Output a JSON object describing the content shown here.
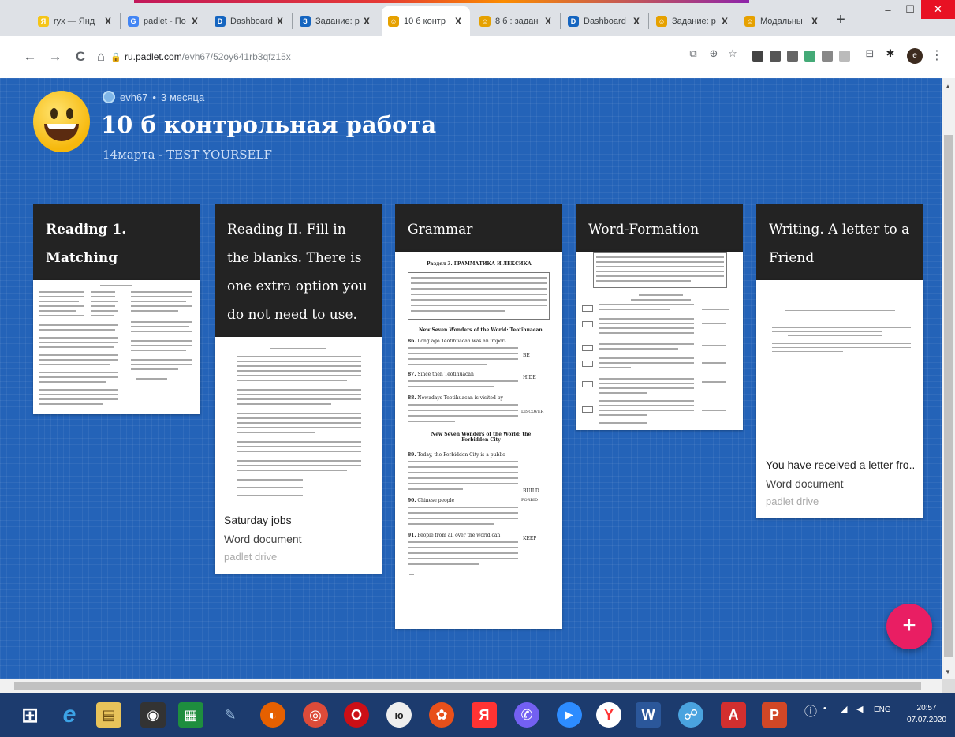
{
  "browser": {
    "tabs": [
      {
        "label": "ryx — Янд",
        "icon": "yandex-icon",
        "color": "#f5c518",
        "glyph": "Я"
      },
      {
        "label": "padlet - По",
        "icon": "google-icon",
        "color": "#4285f4",
        "glyph": "G"
      },
      {
        "label": "Dashboard",
        "icon": "dashboard-icon",
        "color": "#1565c0",
        "glyph": "D"
      },
      {
        "label": "Задание: р",
        "icon": "dashboard-icon",
        "color": "#1565c0",
        "glyph": "З"
      },
      {
        "label": "10 б контр",
        "icon": "padlet-icon",
        "color": "#e6a100",
        "glyph": "☺",
        "active": true
      },
      {
        "label": "8 б : задан",
        "icon": "padlet-icon",
        "color": "#e6a100",
        "glyph": "☺"
      },
      {
        "label": "Dashboard",
        "icon": "dashboard-icon",
        "color": "#1565c0",
        "glyph": "D"
      },
      {
        "label": "Задание: р",
        "icon": "padlet-icon",
        "color": "#e6a100",
        "glyph": "☺"
      },
      {
        "label": "Модальны",
        "icon": "padlet-icon",
        "color": "#e6a100",
        "glyph": "☺"
      }
    ],
    "close_glyph": "X",
    "new_tab": "+",
    "window": {
      "minimize": "–",
      "maximize": "☐",
      "close": "✕"
    },
    "nav": {
      "back": "←",
      "forward": "→",
      "reload": "C",
      "home": "⌂"
    },
    "url_host": "ru.padlet.com",
    "url_path": "/evh67/52oy641rb3qfz15x",
    "profile_initial": "e",
    "menu": "⋮"
  },
  "padlet": {
    "author": "evh67",
    "time_ago": "3 месяца",
    "separator": "•",
    "title": "10 б контрольная работа",
    "subtitle": "14марта - TEST YOURSELF",
    "columns": [
      {
        "heading": "Reading 1. Matching"
      },
      {
        "heading": "Reading II. Fill in the blanks. There is one extra option you do not need to use.",
        "attachment": {
          "name": "Saturday jobs",
          "type": "Word document",
          "source": "padlet drive"
        }
      },
      {
        "heading": "Grammar",
        "doc": {
          "section_title": "Раздел 3. ГРАММАТИКА И ЛЕКСИКА",
          "subtitle_1": "New Seven Wonders of the World: Teotihuacan",
          "subtitle_2": "New Seven Wonders of the World: the Forbidden City",
          "items": [
            {
              "num": "86.",
              "text": "Long ago Teotihuacan was an impor-",
              "word": "BE"
            },
            {
              "num": "87.",
              "text": "Since then Teotihuacan",
              "word": "HIDE"
            },
            {
              "num": "88.",
              "text": "Nowadays Teotihuacan is visited by",
              "word": "DISCOVER"
            },
            {
              "num": "89.",
              "text": "Today, the Forbidden City is a public",
              "word": "BUILD"
            },
            {
              "num": "90.",
              "text": "Chinese people",
              "word": "FORBID"
            },
            {
              "num": "91.",
              "text": "People from all over the world can",
              "word": "KEEP"
            }
          ]
        }
      },
      {
        "heading": "Word-Formation"
      },
      {
        "heading": "Writing. A letter to a Friend",
        "attachment": {
          "name": "You have received a letter fro...",
          "type": "Word document",
          "source": "padlet drive"
        }
      }
    ],
    "add_button": "+"
  },
  "taskbar": {
    "language": "ENG",
    "time": "20:57",
    "date": "07.07.2020",
    "apps": [
      {
        "name": "start-icon",
        "color": "transparent",
        "glyph": "⊞"
      },
      {
        "name": "internet-explorer-icon",
        "color": "transparent",
        "glyph": "e"
      },
      {
        "name": "file-explorer-icon",
        "color": "#e8c35a",
        "glyph": "▤"
      },
      {
        "name": "webcam-icon",
        "color": "#333",
        "glyph": "◉"
      },
      {
        "name": "calculator-icon",
        "color": "#1e8e3e",
        "glyph": "▦"
      },
      {
        "name": "feather-icon",
        "color": "transparent",
        "glyph": "✎"
      },
      {
        "name": "firefox-icon",
        "color": "#e66000",
        "glyph": "◐"
      },
      {
        "name": "chrome-icon",
        "color": "#dd4b39",
        "glyph": "◎"
      },
      {
        "name": "opera-icon",
        "color": "#cc0f16",
        "glyph": "O"
      },
      {
        "name": "io-icon",
        "color": "#eee",
        "glyph": "ю"
      },
      {
        "name": "media-player-icon",
        "color": "#e8501a",
        "glyph": "✿"
      },
      {
        "name": "yandex-browser-icon",
        "color": "#f33",
        "glyph": "Я"
      },
      {
        "name": "viber-icon",
        "color": "#7360f2",
        "glyph": "✆"
      },
      {
        "name": "zoom-icon",
        "color": "#2d8cff",
        "glyph": "▶"
      },
      {
        "name": "yandex-icon",
        "color": "#fff",
        "glyph": "Y"
      },
      {
        "name": "word-icon",
        "color": "#2b579a",
        "glyph": "W"
      },
      {
        "name": "network-icon",
        "color": "#4aa3df",
        "glyph": "☍"
      },
      {
        "name": "acrobat-icon",
        "color": "#d32f2f",
        "glyph": "A"
      },
      {
        "name": "powerpoint-icon",
        "color": "#d24726",
        "glyph": "P"
      }
    ]
  }
}
